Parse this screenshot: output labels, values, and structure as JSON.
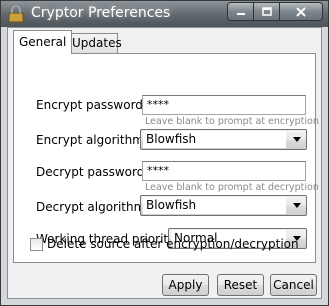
{
  "window": {
    "title": "Cryptor Preferences",
    "minimize_icon": "minimize-icon",
    "maximize_icon": "maximize-icon",
    "close_icon": "close-icon",
    "app_icon": "cryptor-app-icon"
  },
  "tabs": [
    {
      "label": "General",
      "active": true
    },
    {
      "label": "Updates",
      "active": false
    }
  ],
  "general": {
    "encrypt_password_label": "Encrypt password :",
    "encrypt_password_value": "****",
    "encrypt_hint": "Leave blank to prompt at encryption",
    "encrypt_algorithm_label": "Encrypt algorithm :",
    "encrypt_algorithm_value": "Blowfish",
    "decrypt_password_label": "Decrypt password :",
    "decrypt_password_value": "****",
    "decrypt_hint": "Leave blank to prompt at decryption",
    "decrypt_algorithm_label": "Decrypt algorithm :",
    "decrypt_algorithm_value": "Blowfish",
    "thread_priority_label": "Working thread priority :",
    "thread_priority_value": "Normal",
    "delete_source_label": "Delete source after encryption/decryption",
    "delete_source_checked": false
  },
  "buttons": {
    "apply": "Apply",
    "reset": "Reset",
    "cancel": "Cancel"
  }
}
